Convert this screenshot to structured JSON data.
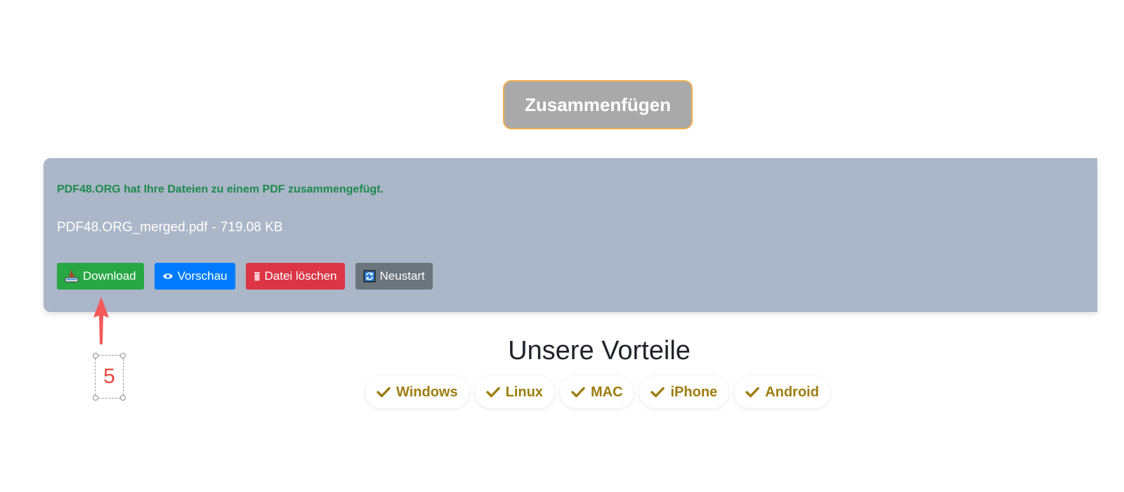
{
  "merge_button": {
    "label": "Zusammenfügen"
  },
  "result": {
    "success_message": "PDF48.ORG hat Ihre Dateien zu einem PDF zusammengefügt.",
    "file_name": "PDF48.ORG_merged.pdf",
    "separator": "-",
    "file_size": "719.08 KB",
    "buttons": {
      "download": {
        "label": "Download",
        "icon": "download-tray-icon",
        "color": "#28a745"
      },
      "preview": {
        "label": "Vorschau",
        "icon": "eye-icon",
        "color": "#007bff"
      },
      "delete": {
        "label": "Datei löschen",
        "icon": "trash-icon",
        "color": "#dc3545"
      },
      "restart": {
        "label": "Neustart",
        "icon": "refresh-icon",
        "color": "#6c757d"
      }
    }
  },
  "annotation": {
    "step_number": "5",
    "color": "#e8453c"
  },
  "advantages": {
    "title": "Unsere Vorteile",
    "platforms": [
      "Windows",
      "Linux",
      "MAC",
      "iPhone",
      "Android"
    ],
    "accent_color": "#9d7d0f"
  }
}
